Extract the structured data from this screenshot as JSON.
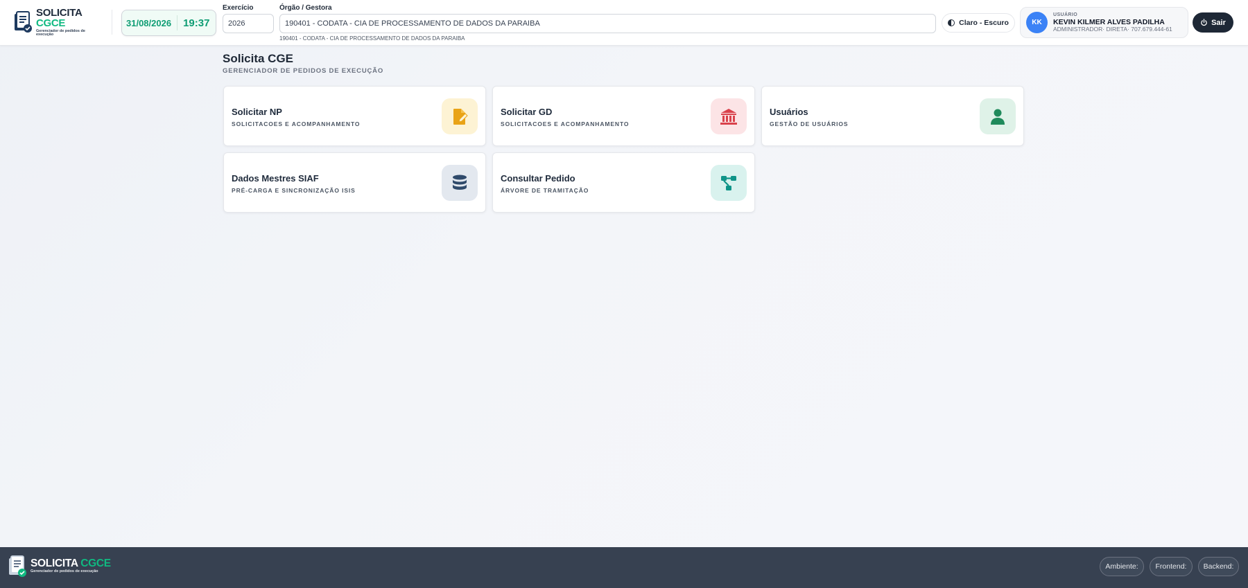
{
  "header": {
    "logo": {
      "title_main": "SOLICITA",
      "title_accent": "CGCE",
      "subtitle": "Gerenciador de pedidos de execução"
    },
    "date": "31/08/2026",
    "time": "19:37",
    "exercicio": {
      "label": "Exercício",
      "value": "2026"
    },
    "orgao": {
      "label": "Órgão / Gestora",
      "value": "190401 - CODATA - CIA DE PROCESSAMENTO DE DADOS DA PARAIBA",
      "hint": "190401 - CODATA - CIA DE PROCESSAMENTO DE DADOS DA PARAIBA"
    },
    "theme_toggle": "Claro - Escuro",
    "user": {
      "initials": "KK",
      "role_label": "USUÁRIO",
      "name": "KEVIN KILMER ALVES PADILHA",
      "meta": "ADMINISTRADOR· DIRETA· 707.679.444-61"
    },
    "logout": "Sair"
  },
  "main": {
    "title": "Solicita CGE",
    "subtitle": "GERENCIADOR DE PEDIDOS DE EXECUÇÃO",
    "cards": [
      {
        "title": "Solicitar NP",
        "subtitle": "SOLICITACOES E ACOMPANHAMENTO",
        "icon": "file-edit-icon",
        "icon_color": "#e9a316",
        "icon_bg": "#fdf3d4"
      },
      {
        "title": "Solicitar GD",
        "subtitle": "SOLICITACOES E ACOMPANHAMENTO",
        "icon": "bank-icon",
        "icon_color": "#d9424c",
        "icon_bg": "#fce4e6"
      },
      {
        "title": "Usuários",
        "subtitle": "GESTÃO DE USUÁRIOS",
        "icon": "user-icon",
        "icon_color": "#1f8a5b",
        "icon_bg": "#dff2e8"
      },
      {
        "title": "Dados Mestres SIAF",
        "subtitle": "PRÉ-CARGA E SINCRONIZAÇÃO ISIS",
        "icon": "database-icon",
        "icon_color": "#2f4a6b",
        "icon_bg": "#e3e8ef"
      },
      {
        "title": "Consultar Pedido",
        "subtitle": "ÁRVORE DE TRAMITAÇÃO",
        "icon": "sitemap-icon",
        "icon_color": "#0f9488",
        "icon_bg": "#d9f2ee"
      }
    ]
  },
  "footer": {
    "logo": {
      "title_main": "SOLICITA",
      "title_accent": "CGCE",
      "subtitle": "Gerenciador de pedidos de execução"
    },
    "ambiente": "Ambiente:",
    "frontend": "Frontend:",
    "backend": "Backend:"
  }
}
